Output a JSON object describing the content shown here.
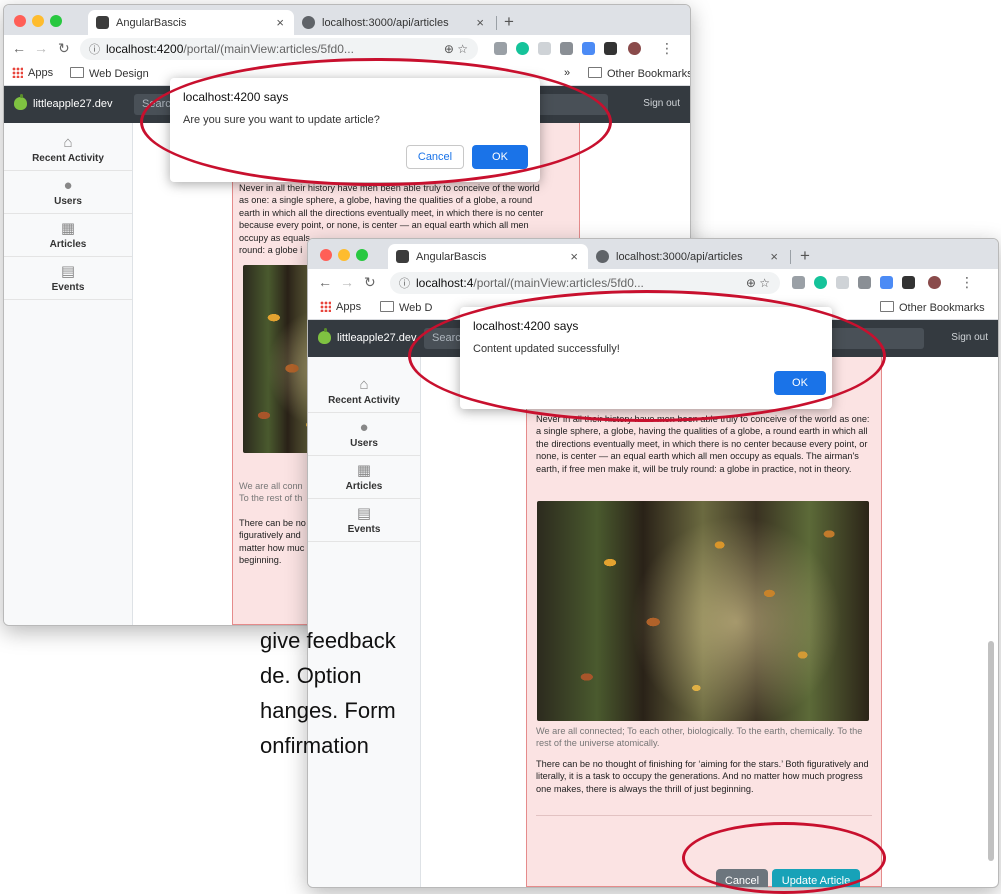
{
  "browser": {
    "tabs": [
      {
        "title": "AngularBascis",
        "icon": "angular-logo-icon"
      },
      {
        "title": "localhost:3000/api/articles",
        "icon": "globe-icon"
      }
    ],
    "new_tab": "+",
    "close": "×",
    "url_host": "localhost:4200",
    "url_path": "/portal/(mainView:articles/5fd0...",
    "url_host_back": "localhost:4",
    "url_path_back": "/portal/(mainView:articles/5fd0...",
    "bookmarks": {
      "apps": "Apps",
      "web_design": "Web Design",
      "web_design_short": "Web D",
      "other": "Other Bookmarks",
      "more": "»"
    }
  },
  "app": {
    "brand": "littleapple27.dev",
    "search_placeholder": "Search",
    "sign_out": "Sign out",
    "nav": [
      {
        "label": "Recent Activity",
        "icon": "home-icon"
      },
      {
        "label": "Users",
        "icon": "user-icon"
      },
      {
        "label": "Articles",
        "icon": "newspaper-icon"
      },
      {
        "label": "Events",
        "icon": "calendar-icon"
      }
    ]
  },
  "dialog_confirm": {
    "title": "localhost:4200 says",
    "message": "Are you sure you want to update article?",
    "cancel": "Cancel",
    "ok": "OK"
  },
  "dialog_success": {
    "title": "localhost:4200 says",
    "message": "Content updated successfully!",
    "ok": "OK"
  },
  "article": {
    "p1": "Never in all their history have men been able truly to conceive of the world as one: a single sphere, a globe, having the qualities of a globe, a round earth in which all the directions eventually meet, in which there is no center because every point, or none, is center — an equal earth which all men occupy as equals. The airman's earth, if free men make it, will be truly round: a globe in practice, not in theory.",
    "caption": "We are all connected; To each other, biologically. To the earth, chemically. To the rest of the universe atomically.",
    "p2": "There can be no thought of finishing for ‘aiming for the stars.’ Both figuratively and literally, it is a task to occupy the generations. And no matter how much progress one makes, there is always the thrill of just beginning.",
    "cancel": "Cancel",
    "update": "Update Article"
  },
  "article_back_fragments": {
    "p1_line1": "Never in all their history have men been able truly to conceive of the world",
    "p1_line2": "as one: a single sphere, a globe, having the qualities of a globe, a round",
    "p1_line3": "earth in which all the directions eventually meet, in which there is no center",
    "p1_line4": "because every point, or none, is center — an equal earth which all men",
    "p1_line5": "occupy as equals.",
    "p1_line6": "round: a globe i",
    "cap_line1": "We are all conn",
    "cap_line2": "To the rest of th",
    "p2_line1": "There can be no",
    "p2_line2": "figuratively and",
    "p2_line3": "matter how muc",
    "p2_line4": "beginning."
  },
  "slide_text": {
    "line1": "give feedback",
    "line2": "de.  Option",
    "line3": "hanges.  Form",
    "line4": "onfirmation"
  },
  "colors": {
    "annotation": "#c8102e",
    "chrome_blue": "#1a73e8",
    "nav_dark": "#343a40",
    "article_bg": "#fbe3e3"
  }
}
